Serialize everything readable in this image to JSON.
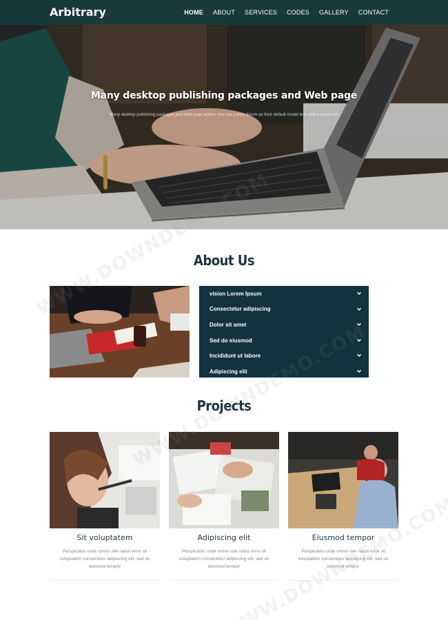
{
  "header": {
    "brand": "Arbitrary",
    "nav": [
      "HOME",
      "ABOUT",
      "SERVICES",
      "CODES",
      "GALLERY",
      "CONTACT"
    ],
    "active_nav": "HOME"
  },
  "hero": {
    "title": "Many desktop publishing packages and Web page",
    "subtitle": "Many desktop publishing packages and Web page editors now use Lorem Ipsum as their default model text, and a search for"
  },
  "about": {
    "title": "About Us",
    "accordion": [
      "vision Lorem Ipsum",
      "Consectetur adipiscing",
      "Dolor sit amet",
      "Sed do eiusmod",
      "Incididunt ut labore",
      "Adipiscing elit"
    ]
  },
  "projects": {
    "title": "Projects",
    "items": [
      {
        "name": "Sit voluptatem",
        "desc": "Perspiciatis unde omnis iste natus error sit voluptatem consectetur adipiscing elit, sed do eiusmod tempor"
      },
      {
        "name": "Adipiscing elit",
        "desc": "Perspiciatis unde omnis iste natus error sit voluptatem consectetur adipiscing elit, sed do eiusmod tempor"
      },
      {
        "name": "Eiusmod tempor",
        "desc": "Perspiciatis unde omnis iste natus error sit voluptatem consectetur adipiscing elit, sed do eiusmod tempor"
      }
    ]
  },
  "watermark": "WWW.DOWNDEMO.COM",
  "colors": {
    "navbar": "#143c3c",
    "accordion_bg": "#133240",
    "heading": "#1e3540"
  },
  "icons": {
    "accordion_toggle": "chevron-down-icon"
  }
}
